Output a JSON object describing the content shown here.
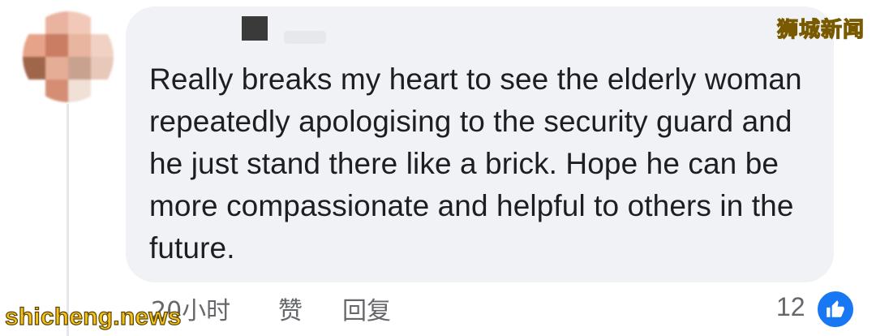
{
  "comment": {
    "text": "Really breaks my heart to see the elderly woman repeatedly apologising to the security guard and he just stand there like a brick. Hope he can be more compassionate and helpful to others in the future.",
    "time": "20小时",
    "like_label": "赞",
    "reply_label": "回复",
    "reaction_count": "12",
    "reaction_icon": "thumbs-up-icon"
  },
  "watermarks": {
    "top_right": "狮城新闻",
    "bottom_left": "shicheng.news"
  },
  "colors": {
    "bubble_bg": "#f0f2f5",
    "text": "#1c1e21",
    "meta_text": "#65676b",
    "like_blue": "#1877f2",
    "watermark_yellow": "#f4c21a"
  }
}
